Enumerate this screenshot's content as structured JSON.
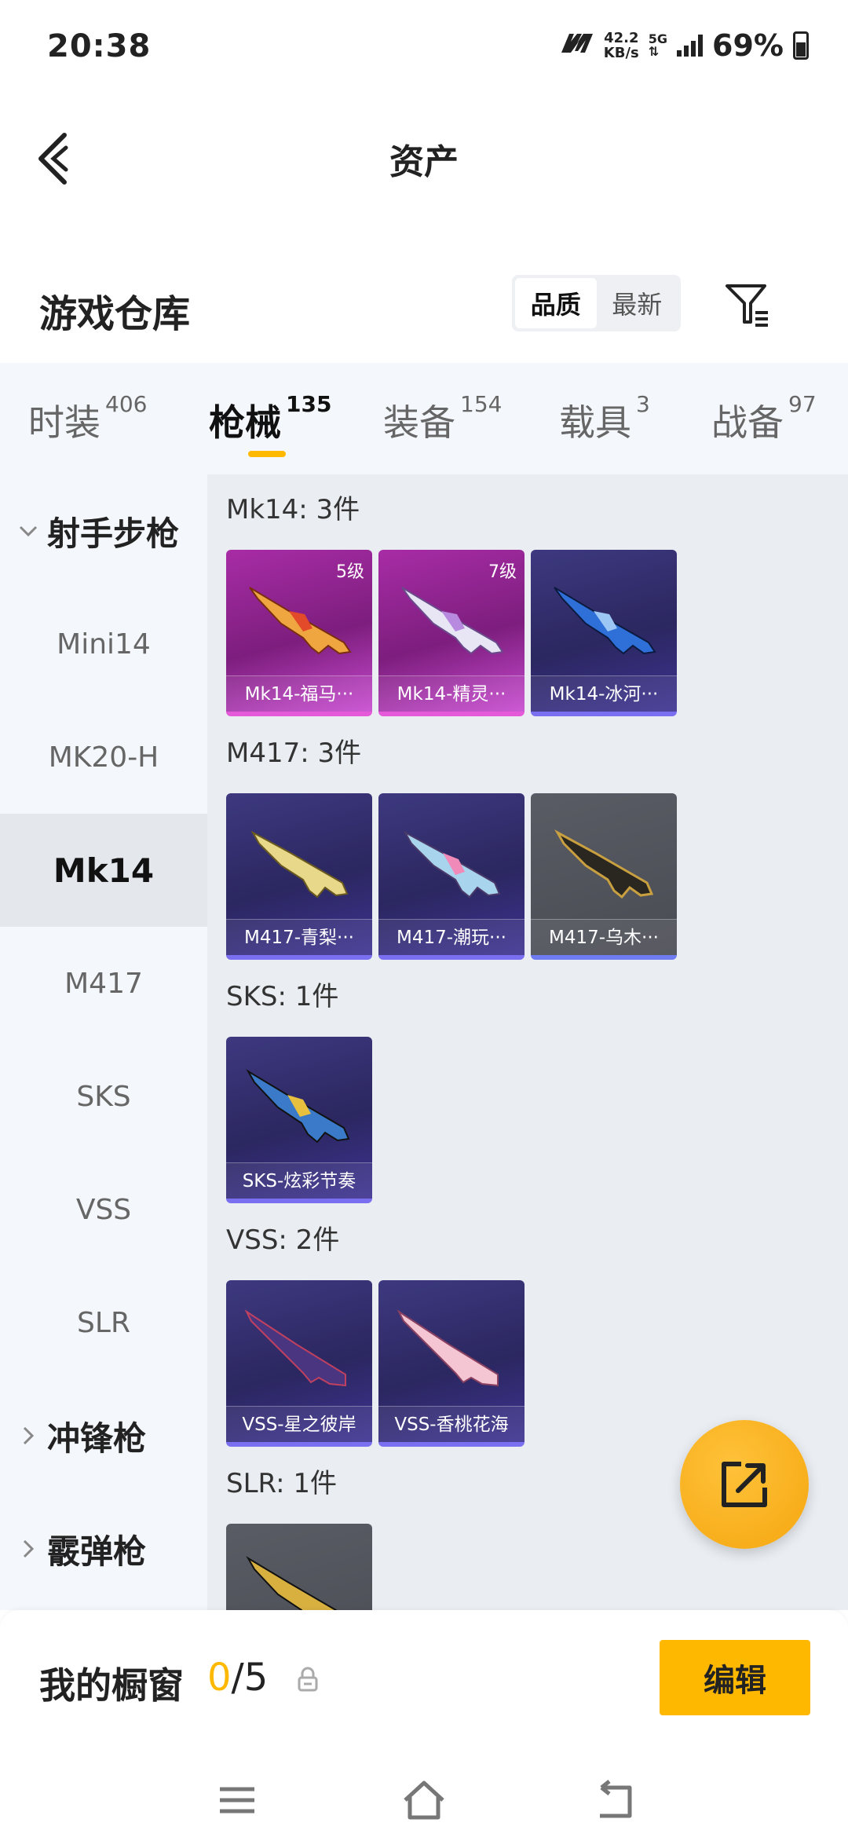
{
  "status_bar": {
    "time": "20:38",
    "speed_value": "42.2",
    "speed_unit": "KB/s",
    "network": "5G",
    "battery": "69%"
  },
  "nav": {
    "title": "资产"
  },
  "warehouse": {
    "title": "游戏仓库",
    "sort_options": [
      "品质",
      "最新"
    ],
    "sort_selected": "品质"
  },
  "tabs": [
    {
      "label": "时装",
      "count": "406"
    },
    {
      "label": "枪械",
      "count": "135"
    },
    {
      "label": "装备",
      "count": "154"
    },
    {
      "label": "载具",
      "count": "3"
    },
    {
      "label": "战备",
      "count": "97"
    }
  ],
  "sidebar": {
    "group_rifle": "射手步枪",
    "items": [
      "Mini14",
      "MK20-H",
      "Mk14",
      "M417",
      "SKS",
      "VSS",
      "SLR"
    ],
    "active": "Mk14",
    "group_smg": "冲锋枪",
    "group_shotgun": "霰弹枪"
  },
  "sections": [
    {
      "title": "Mk14: 3件",
      "cards": [
        {
          "name": "Mk14-福马···",
          "level": "5级"
        },
        {
          "name": "Mk14-精灵···",
          "level": "7级"
        },
        {
          "name": "Mk14-冰河···",
          "level": ""
        }
      ]
    },
    {
      "title": "M417: 3件",
      "cards": [
        {
          "name": "M417-青梨···"
        },
        {
          "name": "M417-潮玩···"
        },
        {
          "name": "M417-乌木···"
        }
      ]
    },
    {
      "title": "SKS: 1件",
      "cards": [
        {
          "name": "SKS-炫彩节奏"
        }
      ]
    },
    {
      "title": "VSS: 2件",
      "cards": [
        {
          "name": "VSS-星之彼岸"
        },
        {
          "name": "VSS-香桃花海"
        }
      ]
    },
    {
      "title": "SLR: 1件",
      "cards": [
        {
          "name": ""
        }
      ]
    }
  ],
  "showcase": {
    "label": "我的橱窗",
    "current": "0",
    "separator": "/",
    "max": "5",
    "edit_label": "编辑"
  },
  "colors": {
    "accent": "#ffb800"
  }
}
